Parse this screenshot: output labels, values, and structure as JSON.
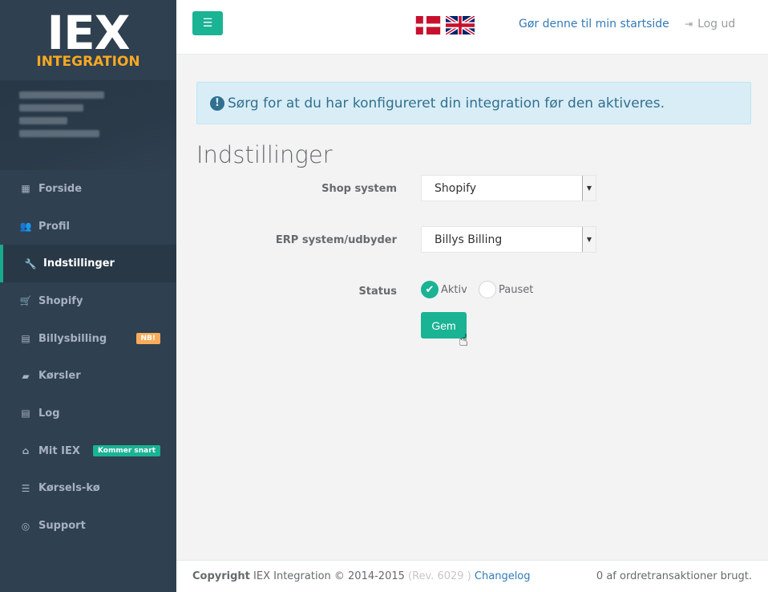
{
  "logo": {
    "main": "IEX",
    "sub": "INTEGRATION"
  },
  "topbar": {
    "menu_icon": "hamburger-icon",
    "home_link": "Gør denne til min startside",
    "logout": "Log ud",
    "logout_icon": "sign-out-icon"
  },
  "sidebar": {
    "items": [
      {
        "label": "Forside",
        "icon": "th-large-icon",
        "glyph": "▦"
      },
      {
        "label": "Profil",
        "icon": "users-icon",
        "glyph": "👥"
      },
      {
        "label": "Indstillinger",
        "icon": "wrench-icon",
        "glyph": "🔧",
        "active": true
      },
      {
        "label": "Shopify",
        "icon": "cart-icon",
        "glyph": "🛒"
      },
      {
        "label": "Billysbilling",
        "icon": "calculator-icon",
        "glyph": "▤",
        "badge": "NB!"
      },
      {
        "label": "Kørsler",
        "icon": "book-icon",
        "glyph": "▰"
      },
      {
        "label": "Log",
        "icon": "list-alt-icon",
        "glyph": "▤"
      },
      {
        "label": "Mit IEX",
        "icon": "home-icon",
        "glyph": "⌂",
        "badge": "Kommer snart"
      },
      {
        "label": "Kørsels-kø",
        "icon": "list-icon",
        "glyph": "☰"
      },
      {
        "label": "Support",
        "icon": "life-ring-icon",
        "glyph": "◎"
      }
    ]
  },
  "alert": {
    "text": "Sørg for at du har konfigureret din integration før den aktiveres.",
    "icon": "exclamation-circle-icon"
  },
  "page": {
    "title": "Indstillinger"
  },
  "form": {
    "shop_label": "Shop system",
    "shop_value": "Shopify",
    "erp_label": "ERP system/udbyder",
    "erp_value": "Billys Billing",
    "status_label": "Status",
    "status_active": "Aktiv",
    "status_paused": "Pauset",
    "save": "Gem"
  },
  "footer": {
    "copyright_bold": "Copyright",
    "copyright_text": " IEX Integration © 2014-2015 ",
    "rev": "(Rev. 6029 )",
    "changelog": "Changelog",
    "right": "0 af ordretransaktioner brugt."
  },
  "colors": {
    "sidebar": "#2f4050",
    "accent": "#1ab394",
    "warning": "#f8ac59",
    "link": "#337ab7",
    "logo_orange": "#f7a823"
  }
}
